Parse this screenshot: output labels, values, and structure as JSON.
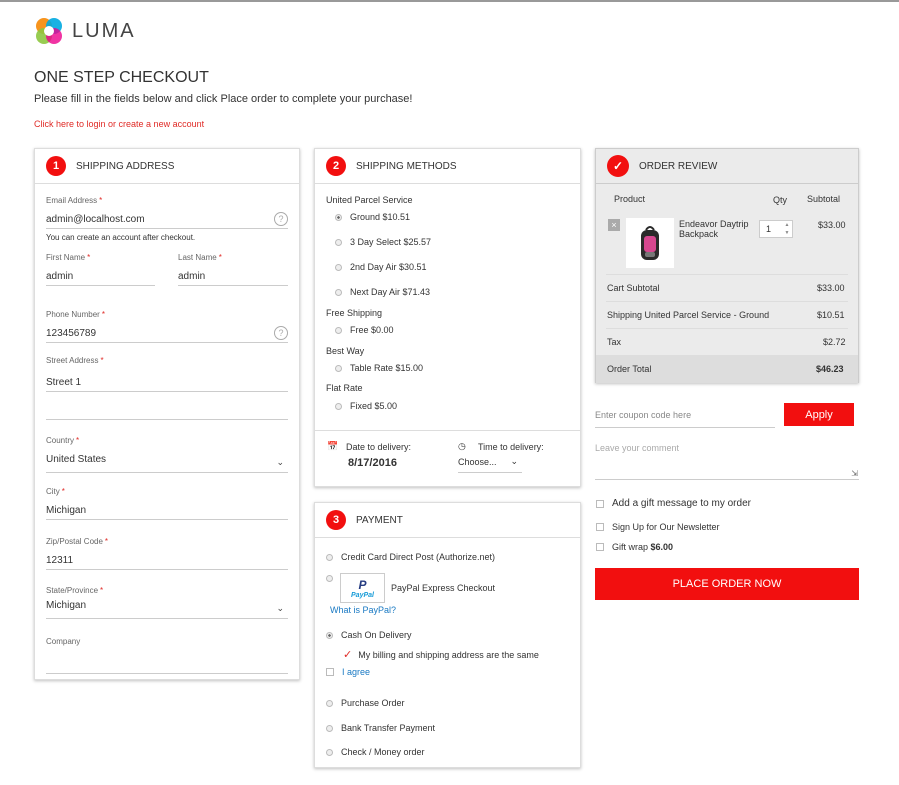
{
  "brand": {
    "name": "LUMA"
  },
  "page": {
    "title": "ONE STEP CHECKOUT",
    "subtitle": "Please fill in the fields below and click Place order to complete your purchase!",
    "login_link": "Click here to login or create a new account"
  },
  "shipping_address": {
    "step": "1",
    "title": "SHIPPING ADDRESS",
    "email": {
      "label": "Email Address",
      "value": "admin@localhost.com",
      "note": "You can create an account after checkout."
    },
    "first_name": {
      "label": "First Name",
      "value": "admin"
    },
    "last_name": {
      "label": "Last Name",
      "value": "admin"
    },
    "phone": {
      "label": "Phone Number",
      "value": "123456789"
    },
    "street": {
      "label": "Street Address",
      "value": "Street 1",
      "value2": ""
    },
    "country": {
      "label": "Country",
      "value": "United States"
    },
    "city": {
      "label": "City",
      "value": "Michigan"
    },
    "zip": {
      "label": "Zip/Postal Code",
      "value": "12311"
    },
    "state": {
      "label": "State/Province",
      "value": "Michigan"
    },
    "company": {
      "label": "Company",
      "value": ""
    },
    "required_mark": "*",
    "help_glyph": "?"
  },
  "shipping_methods": {
    "step": "2",
    "title": "SHIPPING METHODS",
    "carriers": [
      {
        "name": "United Parcel Service",
        "methods": [
          {
            "label": "Ground $10.51",
            "selected": true
          },
          {
            "label": "3 Day Select $25.57",
            "selected": false
          },
          {
            "label": "2nd Day Air $30.51",
            "selected": false
          },
          {
            "label": "Next Day Air $71.43",
            "selected": false
          }
        ]
      },
      {
        "name": "Free Shipping",
        "methods": [
          {
            "label": "Free $0.00",
            "selected": false
          }
        ]
      },
      {
        "name": "Best Way",
        "methods": [
          {
            "label": "Table Rate $15.00",
            "selected": false
          }
        ]
      },
      {
        "name": "Flat Rate",
        "methods": [
          {
            "label": "Fixed $5.00",
            "selected": false
          }
        ]
      }
    ],
    "date_label": "Date to delivery:",
    "date_value": "8/17/2016",
    "time_label": "Time to delivery:",
    "time_value": "Choose..."
  },
  "payment": {
    "step": "3",
    "title": "PAYMENT",
    "methods": {
      "credit_card": "Credit Card Direct Post (Authorize.net)",
      "paypal": "PayPal Express Checkout",
      "paypal_logo_p": "P",
      "paypal_logo_word": "PayPal",
      "what_is_paypal": "What is PayPal?",
      "cod": "Cash On Delivery",
      "same_address": "My billing and shipping address are the same",
      "agree": "I agree",
      "purchase_order": "Purchase Order",
      "bank_transfer": "Bank Transfer Payment",
      "check_money": "Check / Money order"
    }
  },
  "order_review": {
    "title": "ORDER REVIEW",
    "check_glyph": "✓",
    "headers": {
      "product": "Product",
      "qty": "Qty",
      "subtotal": "Subtotal"
    },
    "item": {
      "name": "Endeavor Daytrip Backpack",
      "qty": "1",
      "subtotal": "$33.00",
      "remove_glyph": "×"
    },
    "totals": {
      "cart_subtotal_label": "Cart Subtotal",
      "cart_subtotal": "$33.00",
      "shipping_label": "Shipping United Parcel Service - Ground",
      "shipping": "$10.51",
      "tax_label": "Tax",
      "tax": "$2.72",
      "order_total_label": "Order Total",
      "order_total": "$46.23"
    }
  },
  "extras": {
    "coupon_placeholder": "Enter coupon code here",
    "apply_label": "Apply",
    "comment_placeholder": "Leave your comment",
    "gift_message": "Add a gift message to my order",
    "newsletter": "Sign Up for Our Newsletter",
    "gift_wrap_label": "Gift wrap ",
    "gift_wrap_price": "$6.00",
    "place_order": "PLACE ORDER NOW"
  },
  "colors": {
    "accent": "#f20f0f",
    "link": "#1979c3"
  }
}
